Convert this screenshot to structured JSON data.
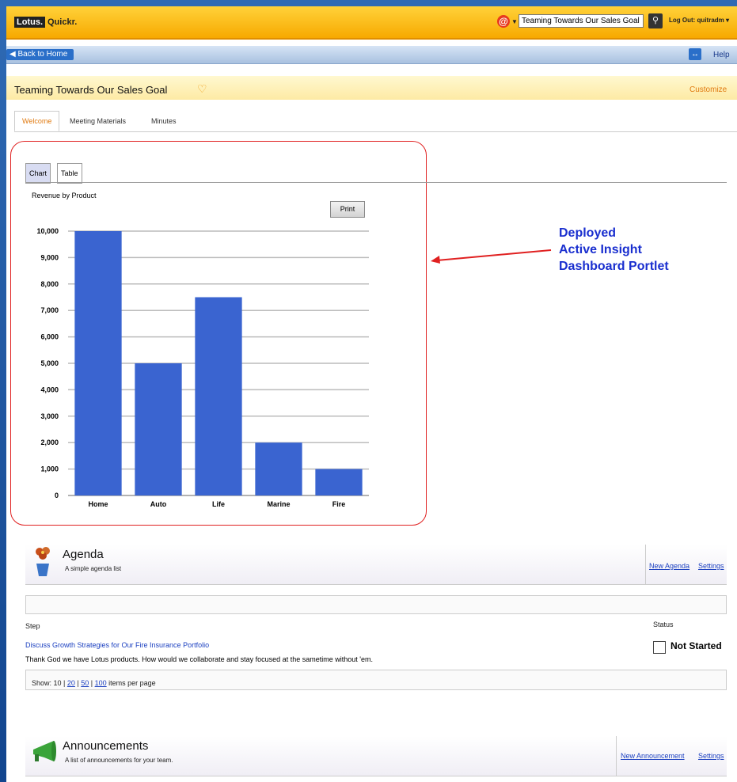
{
  "topbar": {
    "logo_lotus": "Lotus.",
    "logo_quickr": "Quickr.",
    "search_value": "Teaming Towards Our Sales Goal",
    "logout": "Log Out: quitradm"
  },
  "navbar": {
    "back": "Back to Home",
    "help": "Help"
  },
  "place": {
    "title": "Teaming Towards Our Sales Goal",
    "customize": "Customize"
  },
  "tabs": [
    "Welcome",
    "Meeting Materials",
    "Minutes"
  ],
  "portlet": {
    "tabs": [
      "Chart",
      "Table"
    ],
    "print": "Print",
    "annotation_lines": [
      "Deployed",
      "Active Insight",
      "Dashboard Portlet"
    ]
  },
  "chart_data": {
    "type": "bar",
    "title": "Revenue by Product",
    "categories": [
      "Home",
      "Auto",
      "Life",
      "Marine",
      "Fire"
    ],
    "values": [
      10000,
      5000,
      7500,
      2000,
      1000
    ],
    "ylim": [
      0,
      10000
    ],
    "yticks": [
      "0",
      "1,000",
      "2,000",
      "3,000",
      "4,000",
      "5,000",
      "6,000",
      "7,000",
      "8,000",
      "9,000",
      "10,000"
    ],
    "grid": true,
    "bar_color": "#3a64d0"
  },
  "agenda": {
    "title": "Agenda",
    "description": "A simple agenda list",
    "new_link": "New Agenda",
    "settings": "Settings",
    "col_step": "Step",
    "col_status": "Status",
    "item_title": "Discuss Growth Strategies for Our Fire Insurance Portfolio",
    "item_desc": "Thank God we have Lotus products. How would we collaborate and stay focused at the sametime without 'em.",
    "status": "Not Started",
    "pager_prefix": "Show: 10 |",
    "pager_20": "20",
    "pager_50": "50",
    "pager_100": "100",
    "pager_suffix": "items per page"
  },
  "announcements": {
    "title": "Announcements",
    "description": "A list of announcements for your team.",
    "new_link": "New Announcement",
    "settings": "Settings"
  },
  "colors": {
    "accent_orange": "#e07a10",
    "link_blue": "#1a3fc0",
    "topbar": "#f7a900"
  }
}
